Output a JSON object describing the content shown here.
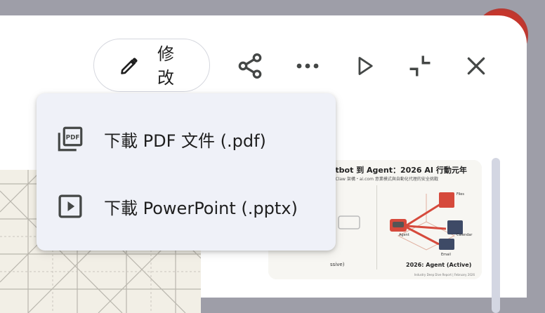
{
  "toolbar": {
    "edit_label": "修改",
    "icons": [
      "pencil-icon",
      "share-icon",
      "more-horiz-icon",
      "play-icon",
      "collapse-icon",
      "close-icon"
    ]
  },
  "menu": {
    "items": [
      {
        "label": "下載 PDF 文件 (.pdf)",
        "icon": "pdf-file-icon"
      },
      {
        "label": "下載 PowerPoint (.pptx)",
        "icon": "slideshow-icon"
      }
    ]
  },
  "slide": {
    "title": "atbot 到 Agent：2026 AI 行動元年",
    "subtitle": "enClaw 架構・ai.com 意業模式與自動化代理的安全挑戰",
    "left_caption": "ssive)",
    "right_caption": "2026: Agent (Active)",
    "node_labels": {
      "files": "Files",
      "agent": "Agent",
      "calendar": "Calendar",
      "email": "Email"
    },
    "footer": "Industry Deep Dive Report | February 2026"
  },
  "colors": {
    "backdrop": "#9e9ea8",
    "panel": "#ffffff",
    "menu": "#eff1f8",
    "text": "#1f1f1f",
    "icon": "#444746",
    "accent_red": "#c5362d"
  }
}
